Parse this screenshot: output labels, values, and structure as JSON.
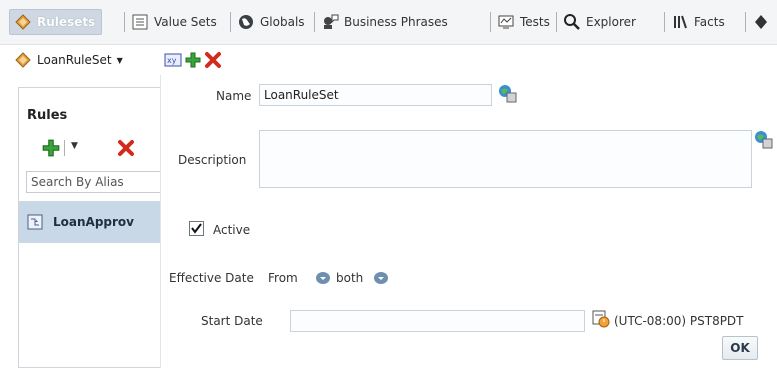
{
  "tabs": [
    {
      "label": "Rulesets",
      "icon": "ruleset-icon",
      "active": true
    },
    {
      "label": "Value Sets",
      "icon": "value-sets-icon",
      "active": false
    },
    {
      "label": "Globals",
      "icon": "globe-icon",
      "active": false
    },
    {
      "label": "Business Phrases",
      "icon": "business-phrases-icon",
      "active": false
    },
    {
      "label": "Tests",
      "icon": "tests-icon",
      "active": false
    },
    {
      "label": "Explorer",
      "icon": "magnifier-icon",
      "active": false
    },
    {
      "label": "Facts",
      "icon": "facts-icon",
      "active": false
    }
  ],
  "toolbar": {
    "ruleset_name": "LoanRuleSet"
  },
  "left_panel": {
    "title": "Rules",
    "search_placeholder": "Search By Alias",
    "items": [
      {
        "label": "LoanApprov"
      }
    ]
  },
  "form": {
    "name_label": "Name",
    "name_value": "LoanRuleSet",
    "description_label": "Description",
    "description_value": "",
    "active_label": "Active",
    "active_checked": true,
    "effective_date_label": "Effective Date",
    "from_label": "From",
    "both_label": "both",
    "start_date_label": "Start Date",
    "start_date_value": "",
    "timezone": "(UTC-08:00) PST8PDT",
    "ok_label": "OK"
  },
  "colors": {
    "active_tab": "#cfd8e2",
    "selected_item": "#c9d8e7",
    "add_green": "#3aa33a",
    "delete_red": "#d12b1e"
  }
}
